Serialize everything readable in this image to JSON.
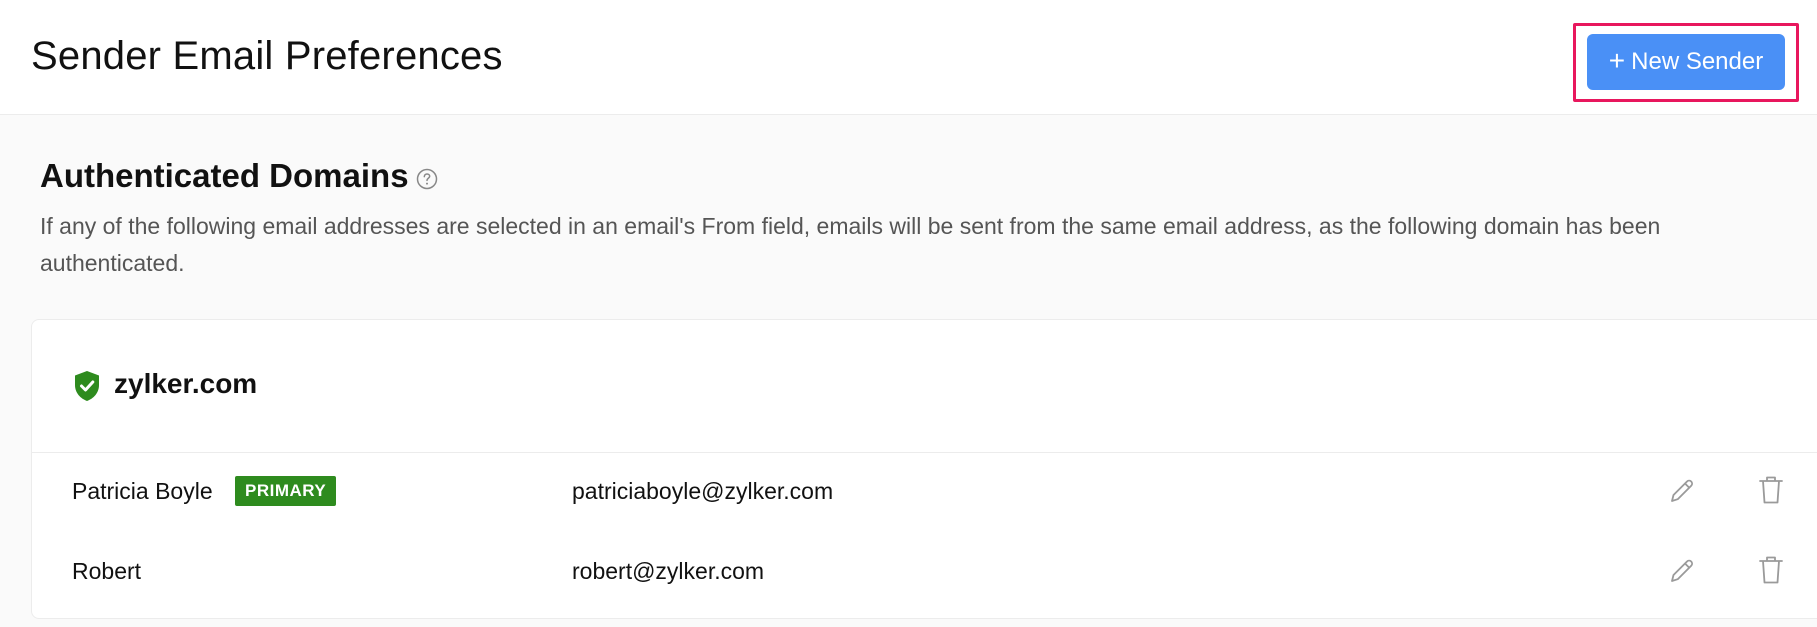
{
  "header": {
    "title": "Sender Email Preferences",
    "new_sender_button": {
      "icon": "+",
      "label": "New Sender",
      "background_color": "#4a90f6",
      "highlight_color": "#e8175d"
    }
  },
  "section": {
    "title": "Authenticated Domains",
    "help_icon": "question-circle-icon",
    "description": "If any of the following email addresses are selected in an email's From field, emails will be sent from the same email address, as the following domain has been authenticated."
  },
  "domain": {
    "name": "zylker.com",
    "status_icon": "shield-check-icon",
    "status_color": "#2e8b1e",
    "senders": [
      {
        "name": "Patricia Boyle",
        "badge": "PRIMARY",
        "email": "patriciaboyle@zylker.com",
        "edit_icon": "pencil-icon",
        "delete_icon": "trash-icon"
      },
      {
        "name": "Robert",
        "badge": "",
        "email": "robert@zylker.com",
        "edit_icon": "pencil-icon",
        "delete_icon": "trash-icon"
      }
    ]
  }
}
